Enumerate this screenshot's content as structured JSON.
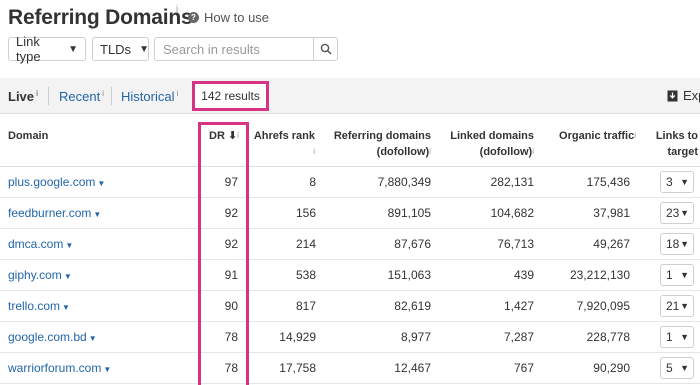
{
  "header": {
    "title": "Referring Domains",
    "title_info": "i",
    "howto_label": "How to use",
    "howto_icon": "?"
  },
  "filters": {
    "link_type": "Link type",
    "tlds": "TLDs",
    "search_placeholder": "Search in results",
    "caret": "▼"
  },
  "tabs": {
    "live": "Live",
    "recent": "Recent",
    "historical": "Historical",
    "info": "i",
    "results": "142 results",
    "export": "Exp"
  },
  "table": {
    "columns": {
      "domain": "Domain",
      "dr": "DR",
      "dr_sort": "⬇",
      "ahrefs_rank": "Ahrefs rank",
      "referring_domains_1": "Referring domains",
      "referring_domains_2": "(dofollow)",
      "linked_domains_1": "Linked domains",
      "linked_domains_2": "(dofollow)",
      "organic_traffic": "Organic traffic",
      "links_1": "Links to",
      "links_2": "target",
      "info": "i"
    },
    "rows": [
      {
        "domain": "plus.google.com",
        "dr": "97",
        "ar": "8",
        "rd": "7,880,349",
        "ld": "282,131",
        "ot": "175,436",
        "links": "3"
      },
      {
        "domain": "feedburner.com",
        "dr": "92",
        "ar": "156",
        "rd": "891,105",
        "ld": "104,682",
        "ot": "37,981",
        "links": "23"
      },
      {
        "domain": "dmca.com",
        "dr": "92",
        "ar": "214",
        "rd": "87,676",
        "ld": "76,713",
        "ot": "49,267",
        "links": "18"
      },
      {
        "domain": "giphy.com",
        "dr": "91",
        "ar": "538",
        "rd": "151,063",
        "ld": "439",
        "ot": "23,212,130",
        "links": "1"
      },
      {
        "domain": "trello.com",
        "dr": "90",
        "ar": "817",
        "rd": "82,619",
        "ld": "1,427",
        "ot": "7,920,095",
        "links": "21"
      },
      {
        "domain": "google.com.bd",
        "dr": "78",
        "ar": "14,929",
        "rd": "8,977",
        "ld": "7,287",
        "ot": "228,778",
        "links": "1"
      },
      {
        "domain": "warriorforum.com",
        "dr": "78",
        "ar": "17,758",
        "rd": "12,467",
        "ld": "767",
        "ot": "90,290",
        "links": "5"
      }
    ]
  },
  "icons": {
    "search": "search-icon",
    "export": "download-icon"
  },
  "colors": {
    "highlight": "#d63384",
    "link": "#2266aa",
    "tabbar_bg": "#f3f3f3"
  }
}
